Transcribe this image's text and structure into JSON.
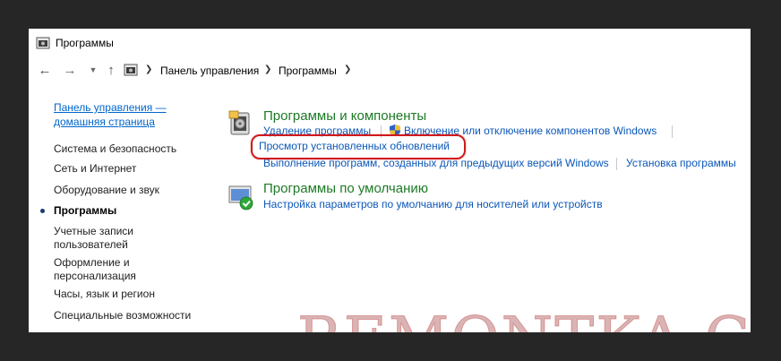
{
  "window": {
    "title": "Программы"
  },
  "address": {
    "crumbs": [
      "Панель управления",
      "Программы"
    ]
  },
  "sidebar": {
    "home_line1": "Панель управления —",
    "home_line2": "домашняя страница",
    "items": [
      {
        "label": "Система и безопасность"
      },
      {
        "label": "Сеть и Интернет"
      },
      {
        "label": "Оборудование и звук"
      },
      {
        "label": "Программы"
      },
      {
        "label_line1": "Учетные записи",
        "label_line2": "пользователей"
      },
      {
        "label_line1": "Оформление и",
        "label_line2": "персонализация"
      },
      {
        "label": "Часы, язык и регион"
      },
      {
        "label": "Специальные возможности"
      }
    ]
  },
  "sections": {
    "programs": {
      "title": "Программы и компоненты",
      "uninstall": "Удаление программы",
      "features": "Включение или отключение компонентов Windows",
      "view_updates": "Просмотр установленных обновлений",
      "compat": "Выполнение программ, созданных для предыдущих версий Windows",
      "install": "Установка программы"
    },
    "defaults": {
      "title": "Программы по умолчанию",
      "media": "Настройка параметров по умолчанию для носителей или устройств"
    }
  },
  "watermark": "REMONTKA.COM",
  "colors": {
    "link": "#0b57b8",
    "section_title": "#1c7a25",
    "highlight": "#d0191c"
  }
}
